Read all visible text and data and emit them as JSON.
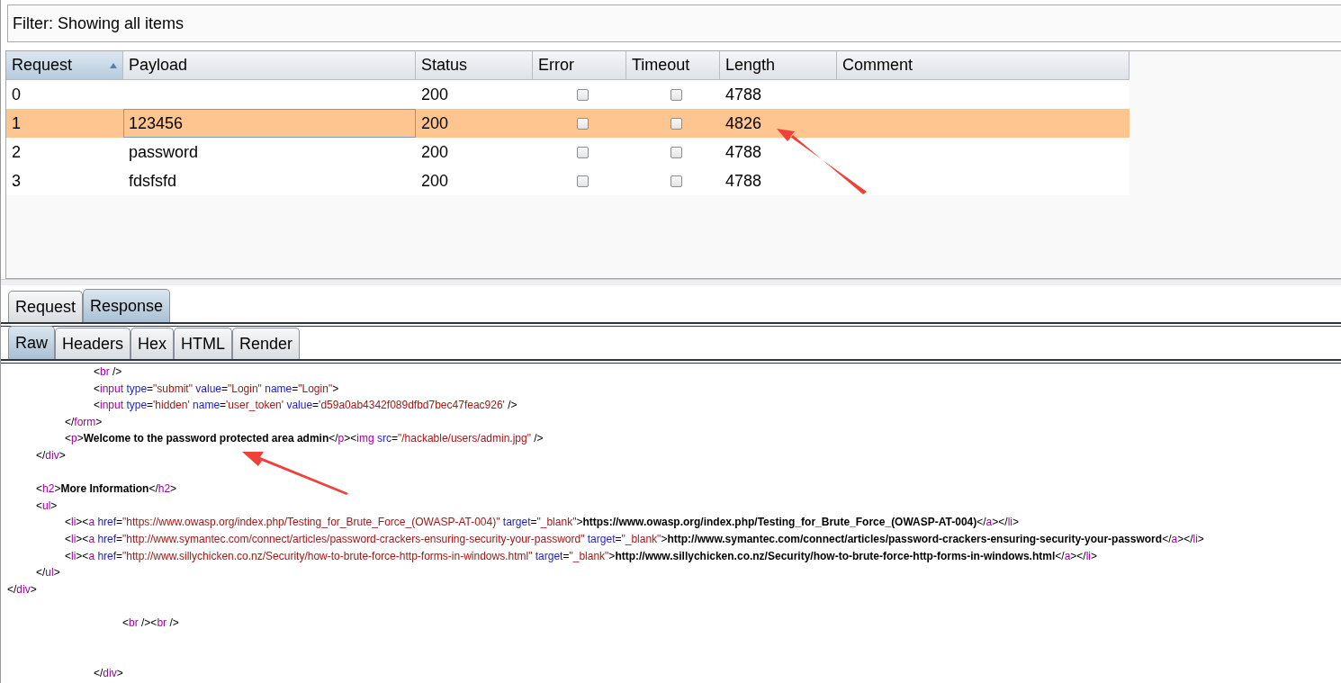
{
  "filter": {
    "label": "Filter: Showing all items"
  },
  "table": {
    "columns": [
      {
        "label": "Request",
        "sorted": true
      },
      {
        "label": "Payload",
        "sorted": false
      },
      {
        "label": "Status",
        "sorted": false
      },
      {
        "label": "Error",
        "sorted": false
      },
      {
        "label": "Timeout",
        "sorted": false
      },
      {
        "label": "Length",
        "sorted": false
      },
      {
        "label": "Comment",
        "sorted": false
      }
    ],
    "rows": [
      {
        "request": "0",
        "status": "200",
        "error": false,
        "timeout": false,
        "length": "4788",
        "selected": false
      },
      {
        "request": "1",
        "payload": "123456",
        "status": "200",
        "error": false,
        "timeout": false,
        "length": "4826",
        "selected": true
      },
      {
        "request": "2",
        "payload": "password",
        "status": "200",
        "error": false,
        "timeout": false,
        "length": "4788",
        "selected": false
      },
      {
        "request": "3",
        "payload": "fdsfsfd",
        "status": "200",
        "error": false,
        "timeout": false,
        "length": "4788",
        "selected": false
      }
    ]
  },
  "message_tabs": [
    {
      "label": "Request",
      "selected": false
    },
    {
      "label": "Response",
      "selected": true
    }
  ],
  "view_tabs": [
    {
      "label": "Raw",
      "selected": true
    },
    {
      "label": "Headers",
      "selected": false
    },
    {
      "label": "Hex",
      "selected": false
    },
    {
      "label": "HTML",
      "selected": false
    },
    {
      "label": "Render",
      "selected": false
    }
  ],
  "code_lines": [
    {
      "kind": "code",
      "tokens": [
        {
          "kind": "punct",
          "text": "\t\t\t<"
        },
        {
          "kind": "tag",
          "text": "br"
        },
        {
          "kind": "punct",
          "text": " />"
        }
      ]
    },
    {
      "kind": "code",
      "tokens": [
        {
          "kind": "punct",
          "text": "\t\t\t<"
        },
        {
          "kind": "tag",
          "text": "input"
        },
        {
          "kind": "attr",
          "text": " type"
        },
        {
          "kind": "punct",
          "text": "="
        },
        {
          "kind": "value",
          "text": "\"submit\""
        },
        {
          "kind": "attr",
          "text": " value"
        },
        {
          "kind": "punct",
          "text": "="
        },
        {
          "kind": "value",
          "text": "\"Login\""
        },
        {
          "kind": "attr",
          "text": " name"
        },
        {
          "kind": "punct",
          "text": "="
        },
        {
          "kind": "value",
          "text": "\"Login\""
        },
        {
          "kind": "punct",
          "text": ">"
        }
      ]
    },
    {
      "kind": "code",
      "tokens": [
        {
          "kind": "punct",
          "text": "\t\t\t<"
        },
        {
          "kind": "tag",
          "text": "input"
        },
        {
          "kind": "attr",
          "text": " type"
        },
        {
          "kind": "punct",
          "text": "="
        },
        {
          "kind": "value",
          "text": "'hidden'"
        },
        {
          "kind": "attr",
          "text": " name"
        },
        {
          "kind": "punct",
          "text": "="
        },
        {
          "kind": "value",
          "text": "'user_token'"
        },
        {
          "kind": "attr",
          "text": " value"
        },
        {
          "kind": "punct",
          "text": "="
        },
        {
          "kind": "value",
          "text": "'d59a0ab4342f089dfbd7bec47feac926'"
        },
        {
          "kind": "punct",
          "text": " />"
        }
      ]
    },
    {
      "kind": "code",
      "tokens": [
        {
          "kind": "punct",
          "text": "\t\t</"
        },
        {
          "kind": "tag",
          "text": "form"
        },
        {
          "kind": "punct",
          "text": ">"
        }
      ]
    },
    {
      "kind": "code",
      "tokens": [
        {
          "kind": "punct",
          "text": "\t\t<"
        },
        {
          "kind": "tag",
          "text": "p"
        },
        {
          "kind": "punct",
          "text": ">"
        },
        {
          "kind": "bold",
          "text": "Welcome to the password protected area admin"
        },
        {
          "kind": "punct",
          "text": "</"
        },
        {
          "kind": "tag",
          "text": "p"
        },
        {
          "kind": "punct",
          "text": "><"
        },
        {
          "kind": "tag",
          "text": "img"
        },
        {
          "kind": "attr",
          "text": " src"
        },
        {
          "kind": "punct",
          "text": "="
        },
        {
          "kind": "value",
          "text": "\"/hackable/users/admin.jpg\""
        },
        {
          "kind": "punct",
          "text": " />"
        }
      ]
    },
    {
      "kind": "code",
      "tokens": [
        {
          "kind": "punct",
          "text": "\t</"
        },
        {
          "kind": "tag",
          "text": "div"
        },
        {
          "kind": "punct",
          "text": ">"
        }
      ]
    },
    {
      "kind": "blank"
    },
    {
      "kind": "code",
      "tokens": [
        {
          "kind": "punct",
          "text": "\t<"
        },
        {
          "kind": "tag",
          "text": "h2"
        },
        {
          "kind": "punct",
          "text": ">"
        },
        {
          "kind": "bold",
          "text": "More Information"
        },
        {
          "kind": "punct",
          "text": "</"
        },
        {
          "kind": "tag",
          "text": "h2"
        },
        {
          "kind": "punct",
          "text": ">"
        }
      ]
    },
    {
      "kind": "code",
      "tokens": [
        {
          "kind": "punct",
          "text": "\t<"
        },
        {
          "kind": "tag",
          "text": "ul"
        },
        {
          "kind": "punct",
          "text": ">"
        }
      ]
    },
    {
      "kind": "code",
      "tokens": [
        {
          "kind": "punct",
          "text": "\t\t<"
        },
        {
          "kind": "tag",
          "text": "li"
        },
        {
          "kind": "punct",
          "text": "><"
        },
        {
          "kind": "tag",
          "text": "a"
        },
        {
          "kind": "attr",
          "text": " href"
        },
        {
          "kind": "punct",
          "text": "="
        },
        {
          "kind": "value",
          "text": "\"https://www.owasp.org/index.php/Testing_for_Brute_Force_(OWASP-AT-004)\""
        },
        {
          "kind": "attr",
          "text": " target"
        },
        {
          "kind": "punct",
          "text": "="
        },
        {
          "kind": "value",
          "text": "\"_blank\""
        },
        {
          "kind": "punct",
          "text": ">"
        },
        {
          "kind": "bold",
          "text": "https://www.owasp.org/index.php/Testing_for_Brute_Force_(OWASP-AT-004)"
        },
        {
          "kind": "punct",
          "text": "</"
        },
        {
          "kind": "tag",
          "text": "a"
        },
        {
          "kind": "punct",
          "text": "></"
        },
        {
          "kind": "tag",
          "text": "li"
        },
        {
          "kind": "punct",
          "text": ">"
        }
      ]
    },
    {
      "kind": "code",
      "tokens": [
        {
          "kind": "punct",
          "text": "\t\t<"
        },
        {
          "kind": "tag",
          "text": "li"
        },
        {
          "kind": "punct",
          "text": "><"
        },
        {
          "kind": "tag",
          "text": "a"
        },
        {
          "kind": "attr",
          "text": " href"
        },
        {
          "kind": "punct",
          "text": "="
        },
        {
          "kind": "value",
          "text": "\"http://www.symantec.com/connect/articles/password-crackers-ensuring-security-your-password\""
        },
        {
          "kind": "attr",
          "text": " target"
        },
        {
          "kind": "punct",
          "text": "="
        },
        {
          "kind": "value",
          "text": "\"_blank\""
        },
        {
          "kind": "punct",
          "text": ">"
        },
        {
          "kind": "bold",
          "text": "http://www.symantec.com/connect/articles/password-crackers-ensuring-security-your-password"
        },
        {
          "kind": "punct",
          "text": "</"
        },
        {
          "kind": "tag",
          "text": "a"
        },
        {
          "kind": "punct",
          "text": "></"
        },
        {
          "kind": "tag",
          "text": "li"
        },
        {
          "kind": "punct",
          "text": ">"
        }
      ]
    },
    {
      "kind": "code",
      "tokens": [
        {
          "kind": "punct",
          "text": "\t\t<"
        },
        {
          "kind": "tag",
          "text": "li"
        },
        {
          "kind": "punct",
          "text": "><"
        },
        {
          "kind": "tag",
          "text": "a"
        },
        {
          "kind": "attr",
          "text": " href"
        },
        {
          "kind": "punct",
          "text": "="
        },
        {
          "kind": "value",
          "text": "\"http://www.sillychicken.co.nz/Security/how-to-brute-force-http-forms-in-windows.html\""
        },
        {
          "kind": "attr",
          "text": " target"
        },
        {
          "kind": "punct",
          "text": "="
        },
        {
          "kind": "value",
          "text": "\"_blank\""
        },
        {
          "kind": "punct",
          "text": ">"
        },
        {
          "kind": "bold",
          "text": "http://www.sillychicken.co.nz/Security/how-to-brute-force-http-forms-in-windows.html"
        },
        {
          "kind": "punct",
          "text": "</"
        },
        {
          "kind": "tag",
          "text": "a"
        },
        {
          "kind": "punct",
          "text": "></"
        },
        {
          "kind": "tag",
          "text": "li"
        },
        {
          "kind": "punct",
          "text": ">"
        }
      ]
    },
    {
      "kind": "code",
      "tokens": [
        {
          "kind": "punct",
          "text": "\t</"
        },
        {
          "kind": "tag",
          "text": "ul"
        },
        {
          "kind": "punct",
          "text": ">"
        }
      ]
    },
    {
      "kind": "code",
      "tokens": [
        {
          "kind": "punct",
          "text": "</"
        },
        {
          "kind": "tag",
          "text": "div"
        },
        {
          "kind": "punct",
          "text": ">"
        }
      ]
    },
    {
      "kind": "blank"
    },
    {
      "kind": "code",
      "tokens": [
        {
          "kind": "punct",
          "text": "\t\t\t\t<"
        },
        {
          "kind": "tag",
          "text": "br"
        },
        {
          "kind": "punct",
          "text": " /><"
        },
        {
          "kind": "tag",
          "text": "br"
        },
        {
          "kind": "punct",
          "text": " />"
        }
      ]
    },
    {
      "kind": "blank"
    },
    {
      "kind": "blank"
    },
    {
      "kind": "code",
      "tokens": [
        {
          "kind": "punct",
          "text": "\t\t\t</"
        },
        {
          "kind": "tag",
          "text": "div"
        },
        {
          "kind": "punct",
          "text": ">"
        }
      ]
    }
  ]
}
